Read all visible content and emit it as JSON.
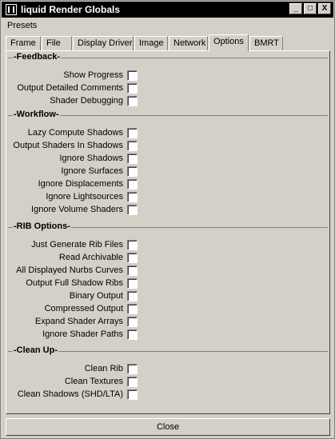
{
  "window": {
    "title": "liquid Render Globals",
    "minimize": "_",
    "maximize": "□",
    "close": "X"
  },
  "menu": {
    "presets": "Presets"
  },
  "tabs": [
    "Frame",
    "File",
    "Display Driver",
    "Image",
    "Network",
    "Options",
    "BMRT"
  ],
  "active_tab": "Options",
  "sections": [
    {
      "title": "-Feedback-",
      "items": [
        "Show Progress",
        "Output Detailed Comments",
        "Shader Debugging"
      ]
    },
    {
      "title": "-Workflow-",
      "items": [
        "Lazy Compute Shadows",
        "Output Shaders In Shadows",
        "Ignore Shadows",
        "Ignore Surfaces",
        "Ignore Displacements",
        "Ignore Lightsources",
        "Ignore Volume Shaders"
      ]
    },
    {
      "title": "-RIB Options-",
      "items": [
        "Just Generate Rib Files",
        "Read Archivable",
        "All Displayed Nurbs Curves",
        "Output Full Shadow Ribs",
        "Binary Output",
        "Compressed Output",
        "Expand Shader Arrays",
        "Ignore Shader Paths"
      ]
    },
    {
      "title": "-Clean Up-",
      "items": [
        "Clean Rib",
        "Clean Textures",
        "Clean Shadows (SHD/LTA)"
      ]
    }
  ],
  "footer": {
    "close": "Close"
  }
}
